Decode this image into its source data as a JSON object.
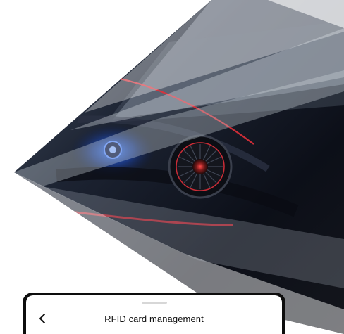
{
  "screen": {
    "title": "RFID card management",
    "back_icon": "chevron-left-icon"
  },
  "colors": {
    "background": "#ffffff",
    "phone_bezel": "#0d0d0d",
    "accent_red": "#e0303a",
    "title_text": "#111111"
  }
}
